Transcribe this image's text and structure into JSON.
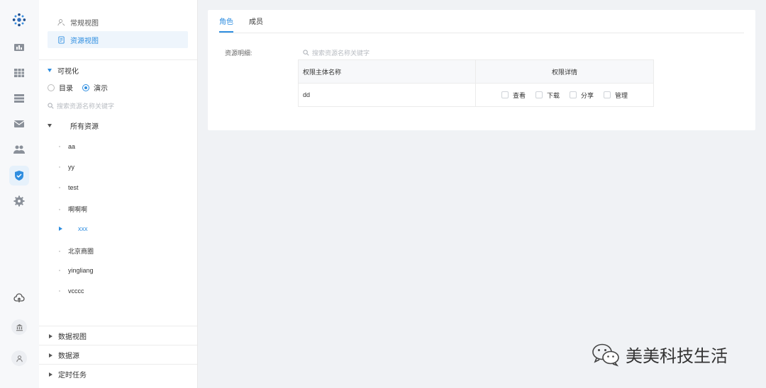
{
  "sidebar": {
    "view_nav": [
      {
        "label": "常规视图",
        "icon": "regular-view-icon"
      },
      {
        "label": "资源视图",
        "icon": "resource-view-icon"
      }
    ],
    "section_visual": "可视化",
    "radio_dir": "目录",
    "radio_demo": "演示",
    "search_placeholder": "搜索资源名称关键字",
    "tree_root": "所有资源",
    "tree_items": [
      "aa",
      "yy",
      "test",
      "啊啊啊",
      "xxx",
      "北京商圈",
      "yingliang",
      "vcccc"
    ],
    "bottom_sections": [
      "数据视图",
      "数据源",
      "定时任务"
    ]
  },
  "main": {
    "tabs": [
      "角色",
      "成员"
    ],
    "detail_label": "资源明细:",
    "search_placeholder": "搜索资源名称关键字",
    "table": {
      "headers": [
        "权限主体名称",
        "权限详情"
      ],
      "rows": [
        {
          "name": "dd",
          "permissions": [
            "查看",
            "下载",
            "分享",
            "管理"
          ]
        }
      ]
    }
  },
  "watermark": "美美科技生活",
  "colors": {
    "accent": "#2f8ee0",
    "background": "#f0f2f5"
  }
}
